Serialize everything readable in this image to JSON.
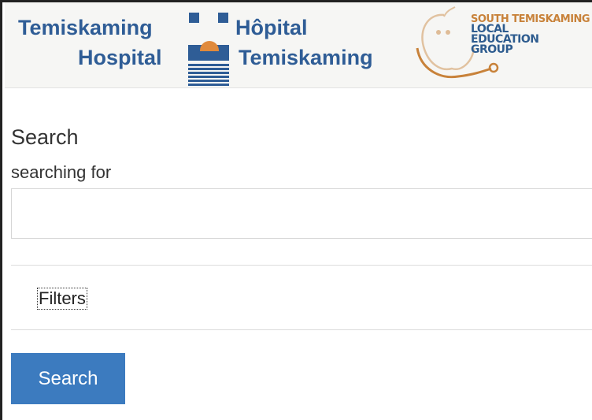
{
  "header": {
    "hospital_en": {
      "line1": "Temiskaming",
      "line2": "Hospital"
    },
    "hospital_fr": {
      "line1": "Hôpital",
      "line2": "Temiskaming"
    },
    "leg": {
      "line1": "SOUTH TEMISKAMING",
      "line2": "LOCAL",
      "line3": "EDUCATION",
      "line4": "GROUP"
    },
    "icons": {
      "hospital_logo": "hospital-logo-icon",
      "leg_logo": "apple-stethoscope-icon"
    }
  },
  "search": {
    "title": "Search",
    "subtitle": "searching for",
    "input_value": "",
    "input_placeholder": ""
  },
  "filters": {
    "label": "Filters"
  },
  "actions": {
    "search_label": "Search"
  },
  "colors": {
    "brand_blue": "#2f5d96",
    "button_blue": "#3c7bbf",
    "leg_orange": "#c8823a",
    "leg_text_blue": "#2e5c8f"
  }
}
